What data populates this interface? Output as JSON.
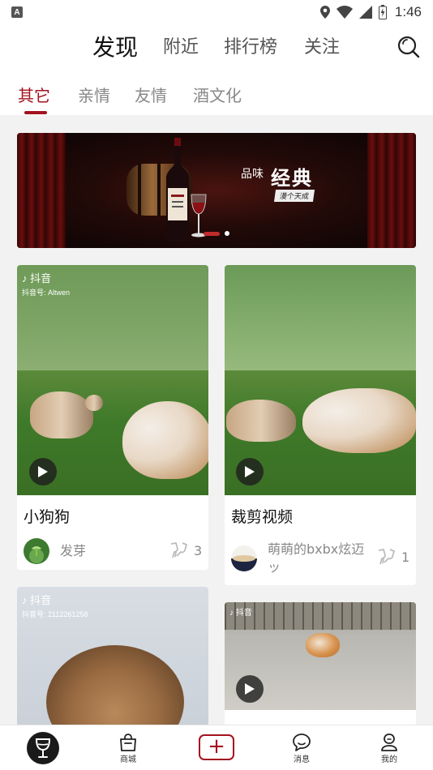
{
  "status_bar": {
    "badge": "A",
    "time": "1:46",
    "icons": [
      "location-icon",
      "wifi-icon",
      "signal-icon",
      "battery-icon"
    ]
  },
  "header": {
    "tabs": [
      {
        "label": "发现",
        "active": true
      },
      {
        "label": "附近",
        "active": false
      },
      {
        "label": "排行榜",
        "active": false
      },
      {
        "label": "关注",
        "active": false
      }
    ],
    "search_icon": "search-icon"
  },
  "sub_tabs": [
    {
      "label": "其它",
      "active": true
    },
    {
      "label": "亲情",
      "active": false
    },
    {
      "label": "友情",
      "active": false
    },
    {
      "label": "酒文化",
      "active": false
    }
  ],
  "banner": {
    "headline_prefix": "品味",
    "headline_main": "经典",
    "slogan": "漫个天成",
    "pager": {
      "active_index": 0,
      "count": 2
    }
  },
  "feed": {
    "cards": [
      {
        "title": "小狗狗",
        "author": "发芽",
        "likes": "3",
        "watermark_brand": "抖音",
        "watermark_id": "抖音号: Altwen"
      },
      {
        "title": "裁剪视频",
        "author": "萌萌的bxbx炫迈ッ",
        "likes": "1"
      },
      {
        "watermark_brand": "抖音",
        "watermark_id": "抖音号: 2112261258"
      },
      {
        "watermark_brand": "抖音"
      }
    ]
  },
  "bottom_nav": {
    "items": [
      {
        "label": "",
        "icon": "wine-glass-icon",
        "active": true
      },
      {
        "label": "商城",
        "icon": "shopping-bag-icon"
      },
      {
        "label": "",
        "icon": "plus-icon"
      },
      {
        "label": "消息",
        "icon": "chat-bubble-icon"
      },
      {
        "label": "我的",
        "icon": "profile-icon"
      }
    ]
  },
  "colors": {
    "accent": "#a3121e",
    "background": "#f2f2f2",
    "card": "#ffffff",
    "muted_text": "#888888"
  }
}
